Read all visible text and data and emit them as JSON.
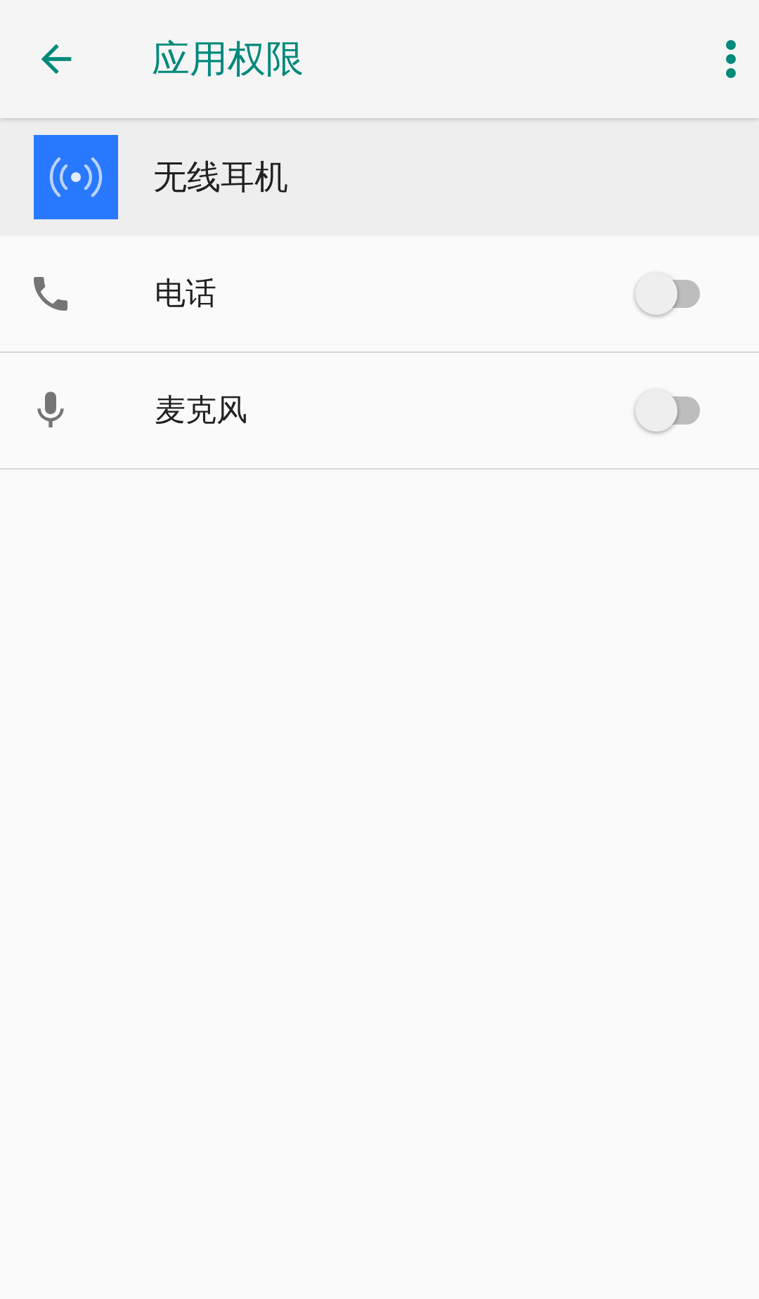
{
  "app_bar": {
    "title": "应用权限"
  },
  "app": {
    "name": "无线耳机"
  },
  "permissions": [
    {
      "kind": "phone",
      "label": "电话",
      "on": false
    },
    {
      "kind": "mic",
      "label": "麦克风",
      "on": false
    }
  ]
}
